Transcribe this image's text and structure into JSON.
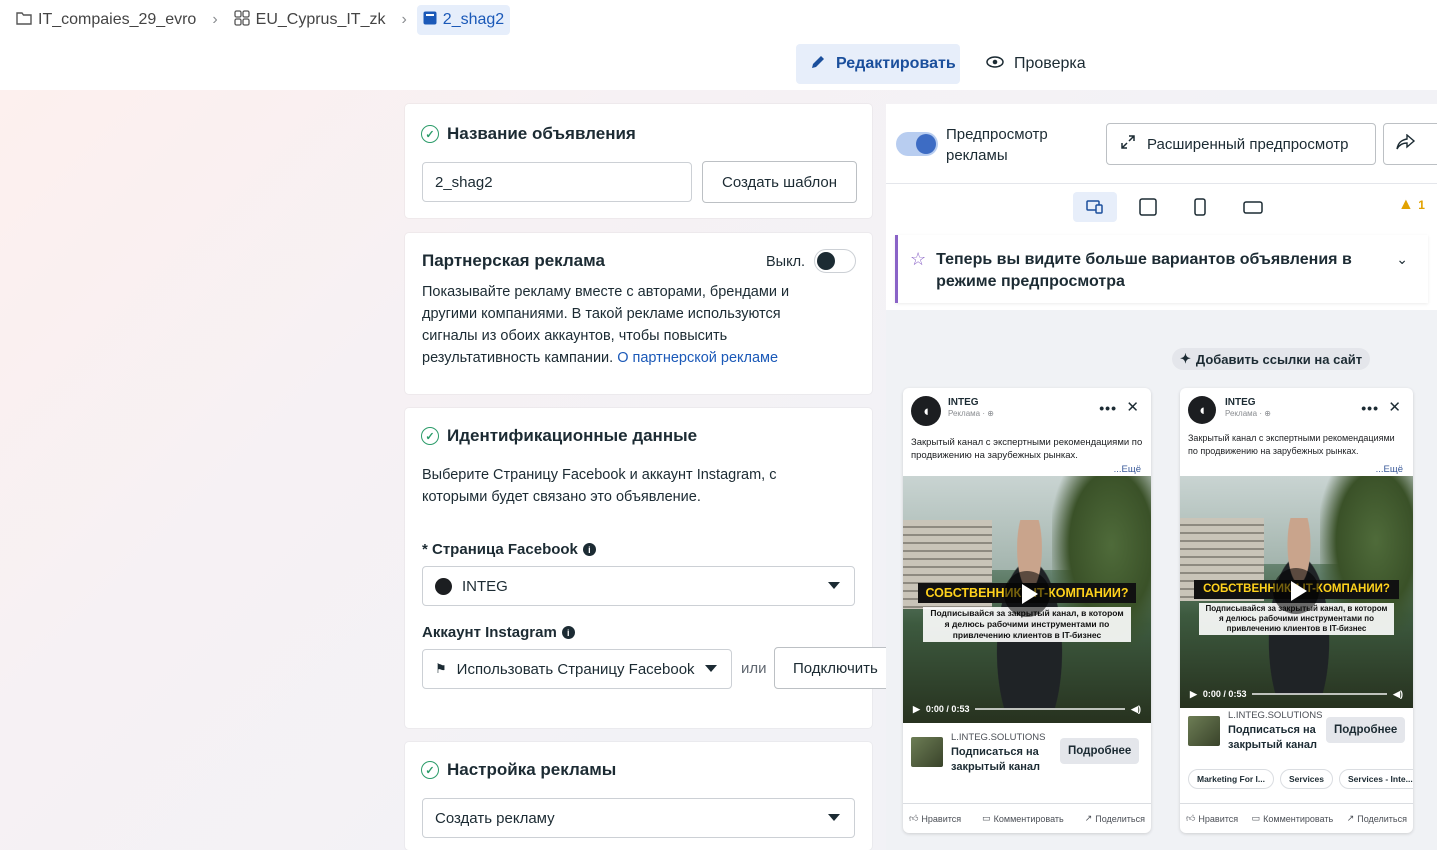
{
  "breadcrumb": {
    "items": [
      {
        "label": "IT_compaies_29_evro",
        "icon": "folder-icon"
      },
      {
        "label": "EU_Cyprus_IT_zk",
        "icon": "grid-icon"
      },
      {
        "label": "2_shag2",
        "icon": "ad-icon"
      }
    ]
  },
  "mode": {
    "edit_label": "Редактировать",
    "check_label": "Проверка"
  },
  "ad_name": {
    "title": "Название объявления",
    "value": "2_shag2",
    "template_button": "Создать шаблон"
  },
  "partner": {
    "title": "Партнерская реклама",
    "toggle_label": "Выкл.",
    "description": "Показывайте рекламу вместе с авторами, брендами и другими компаниями. В такой рекламе используются сигналы из обоих аккаунтов, чтобы повысить результативность кампании.",
    "link": "О партнерской рекламе"
  },
  "identity": {
    "title": "Идентификационные данные",
    "description": "Выберите Страницу Facebook и аккаунт Instagram, с которыми будет связано это объявление.",
    "fb_label": "* Страница Facebook",
    "fb_value": "INTEG",
    "ig_label": "Аккаунт Instagram",
    "ig_value": "Использовать Страницу Facebook",
    "or_label": "или",
    "connect_button": "Подключить"
  },
  "settings": {
    "title": "Настройка рекламы",
    "value": "Создать рекламу"
  },
  "preview": {
    "toggle_label": "Предпросмотр рекламы",
    "expand_button": "Расширенный предпросмотр",
    "warning_count": "1",
    "notice": "Теперь вы видите больше вариантов объявления в режиме предпросмотра",
    "add_links": "Добавить ссылки на сайт"
  },
  "ad_cards": [
    {
      "brand": "INTEG",
      "sponsored": "Реклама · ⊕",
      "copy": "Закрытый канал с экспертными рекомендациями по продвижению на зарубежных рынках.",
      "more": "...Ещё",
      "headline": "СОБСТВЕННИКИ IT-КОМПАНИИ?",
      "subline": "Подписывайся за закрытый канал, в котором я делюсь рабочими инструментами по привлечению клиентов в IT-бизнес",
      "time": "0:00 / 0:53",
      "domain": "L.INTEG.SOLUTIONS",
      "title": "Подписаться на закрытый канал",
      "cta": "Подробнее",
      "chips": [],
      "like": "Нравится",
      "comment": "Комментировать",
      "share": "Поделиться"
    },
    {
      "brand": "INTEG",
      "sponsored": "Реклама · ⊕",
      "copy": "Закрытый канал с экспертными рекомендациями по продвижению на зарубежных рынках.",
      "more": "...Ещё",
      "headline": "СОБСТВЕННИКИ IT-КОМПАНИИ?",
      "subline": "Подписывайся за закрытый канал, в котором я делюсь рабочими инструментами по привлечению клиентов в IT-бизнес",
      "time": "0:00 / 0:53",
      "domain": "L.INTEG.SOLUTIONS",
      "title": "Подписаться на закрытый канал",
      "cta": "Подробнее",
      "chips": [
        "Marketing For I...",
        "Services",
        "Services - Inte..."
      ],
      "like": "Нравится",
      "comment": "Комментировать",
      "share": "Поделиться"
    }
  ],
  "colors": {
    "accent": "#1b59b8",
    "success": "#2c9c6a",
    "notice_border": "#8a63c7",
    "warning": "#e2a200"
  }
}
